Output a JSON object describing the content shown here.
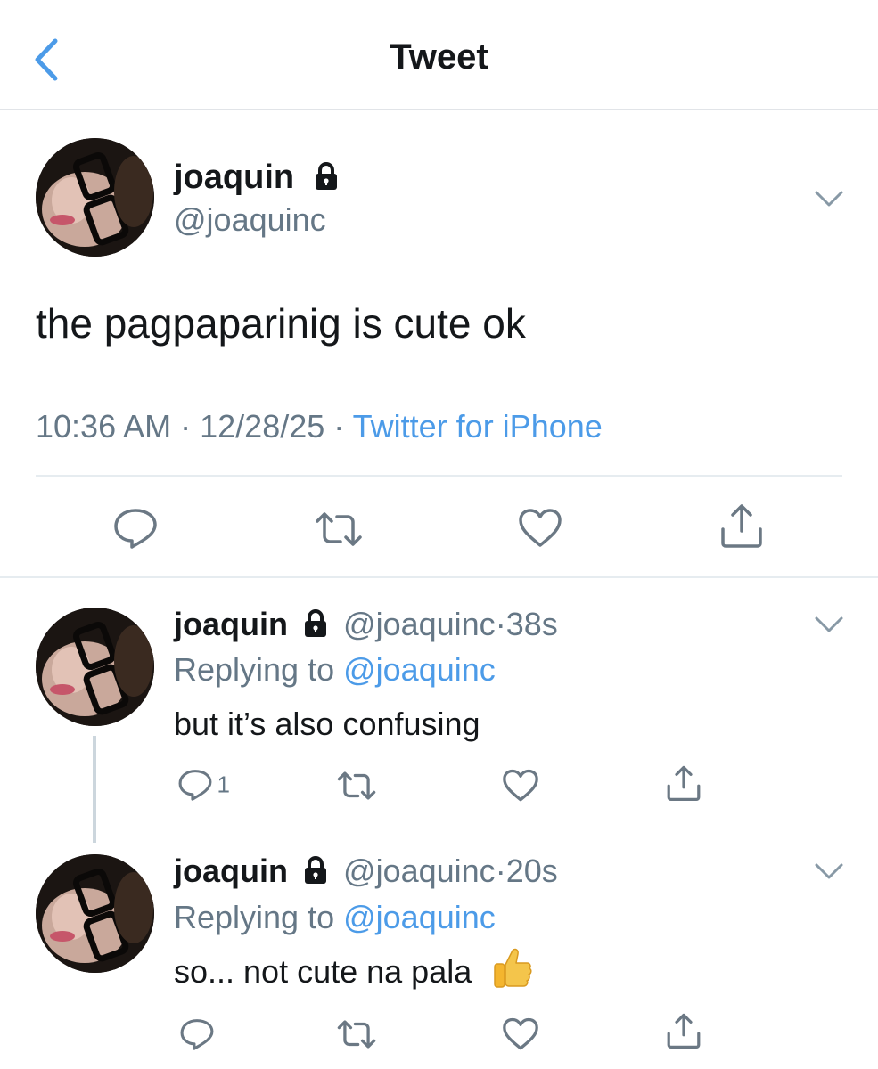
{
  "header": {
    "title": "Tweet",
    "back_icon": "chevron-left-icon"
  },
  "main_tweet": {
    "name": "joaquin",
    "handle": "@joaquinc",
    "text": "the pagpaparinig is cute ok",
    "time": "10:36 AM",
    "sep1": "·",
    "date": "12/28/25",
    "sep2": "·",
    "source": "Twitter for iPhone"
  },
  "replies": [
    {
      "name": "joaquin",
      "handle": "@joaquinc",
      "dot": "·",
      "age": "38s",
      "replying_prefix": "Replying to ",
      "replying_to": "@joaquinc",
      "text": "but it’s also confusing",
      "reply_count": "1"
    },
    {
      "name": "joaquin",
      "handle": "@joaquinc",
      "dot": "·",
      "age": "20s",
      "replying_prefix": "Replying to ",
      "replying_to": "@joaquinc",
      "text": "so... not cute na pala",
      "emoji": "thumbs-up-icon"
    }
  ],
  "colors": {
    "accent": "#4c9be8",
    "muted": "#657786",
    "icon": "#6b7884",
    "divider": "#e6ecf0"
  }
}
